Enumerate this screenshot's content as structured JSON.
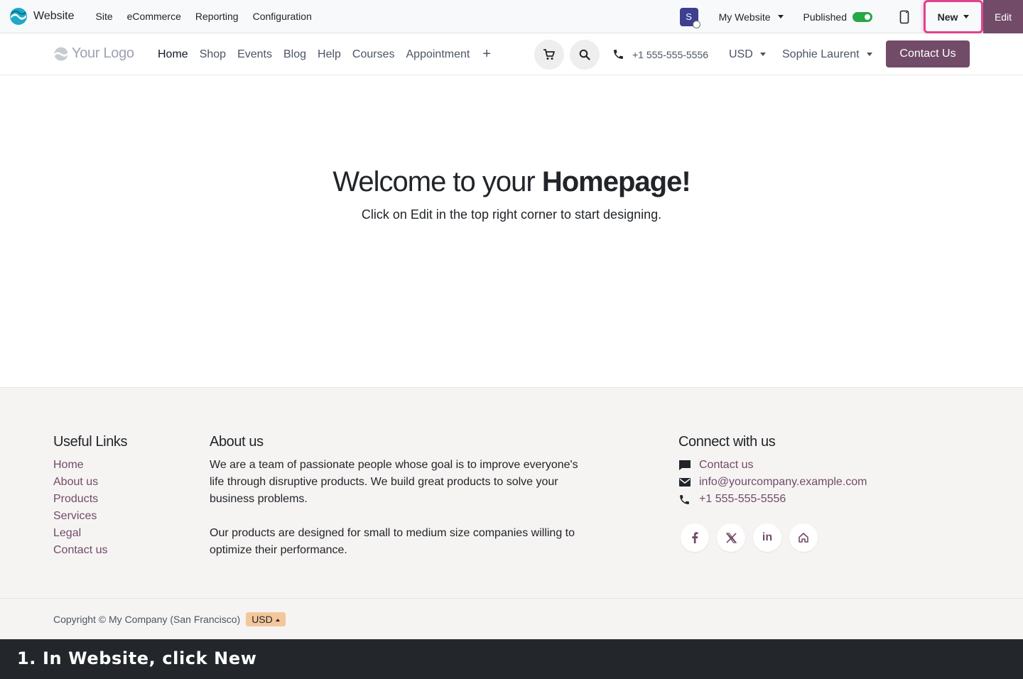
{
  "admin_bar": {
    "app_title": "Website",
    "menu": [
      "Site",
      "eCommerce",
      "Reporting",
      "Configuration"
    ],
    "avatar_letter": "S",
    "website_select": "My Website",
    "published_label": "Published",
    "new_label": "New",
    "edit_label": "Edit"
  },
  "header": {
    "logo_text": "Your Logo",
    "nav": [
      "Home",
      "Shop",
      "Events",
      "Blog",
      "Help",
      "Courses",
      "Appointment"
    ],
    "phone": "+1 555-555-5556",
    "currency": "USD",
    "user_name": "Sophie Laurent",
    "contact_button": "Contact Us"
  },
  "hero": {
    "title_plain": "Welcome to your ",
    "title_bold": "Homepage!",
    "subtitle": "Click on Edit in the top right corner to start designing."
  },
  "footer": {
    "useful_links_title": "Useful Links",
    "useful_links": [
      "Home",
      "About us",
      "Products",
      "Services",
      "Legal",
      "Contact us"
    ],
    "about_title": "About us",
    "about_p1": "We are a team of passionate people whose goal is to improve everyone's life through disruptive products. We build great products to solve your business problems.",
    "about_p2": "Our products are designed for small to medium size companies willing to optimize their performance.",
    "connect_title": "Connect with us",
    "connect_contact": "Contact us",
    "connect_email": "info@yourcompany.example.com",
    "connect_phone": "+1 555-555-5556",
    "copyright": "Copyright © My Company (San Francisco)",
    "currency_badge": "USD"
  },
  "caption": "1. In Website, click New",
  "colors": {
    "brand": "#714b67",
    "highlight": "#e0428e",
    "toggle_on": "#28a745"
  }
}
